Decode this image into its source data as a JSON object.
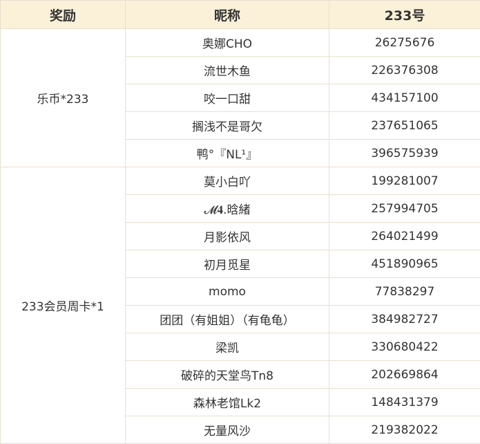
{
  "table": {
    "headers": [
      "奖励",
      "昵称",
      "233号"
    ],
    "groups": [
      {
        "reward": "乐币*233",
        "rows": [
          {
            "nickname": "奥娜CHO",
            "id": "26275676"
          },
          {
            "nickname": "流世木鱼",
            "id": "226376308"
          },
          {
            "nickname": "咬一口甜",
            "id": "434157100"
          },
          {
            "nickname": "搁浅不是哥欠",
            "id": "237651065"
          },
          {
            "nickname": "鸭°『NL¹』",
            "id": "396575939"
          }
        ]
      },
      {
        "reward": "233会员周卡*1",
        "rows": [
          {
            "nickname": "莫小白吖",
            "id": "199281007"
          },
          {
            "nickname": "𝓜𝟒.晗緒",
            "id": "257994705"
          },
          {
            "nickname": "月影依风",
            "id": "264021499"
          },
          {
            "nickname": "初月觅星",
            "id": "451890965"
          },
          {
            "nickname": "momo",
            "id": "77838297"
          },
          {
            "nickname": "团团（有姐姐）（有龟龟）",
            "id": "384982727"
          },
          {
            "nickname": "梁凯",
            "id": "330680422"
          },
          {
            "nickname": "破碎的天堂鸟Tn8",
            "id": "202669864"
          },
          {
            "nickname": "森林老馆Lk2",
            "id": "148431379"
          },
          {
            "nickname": "无量风沙",
            "id": "219382022"
          }
        ]
      }
    ]
  }
}
